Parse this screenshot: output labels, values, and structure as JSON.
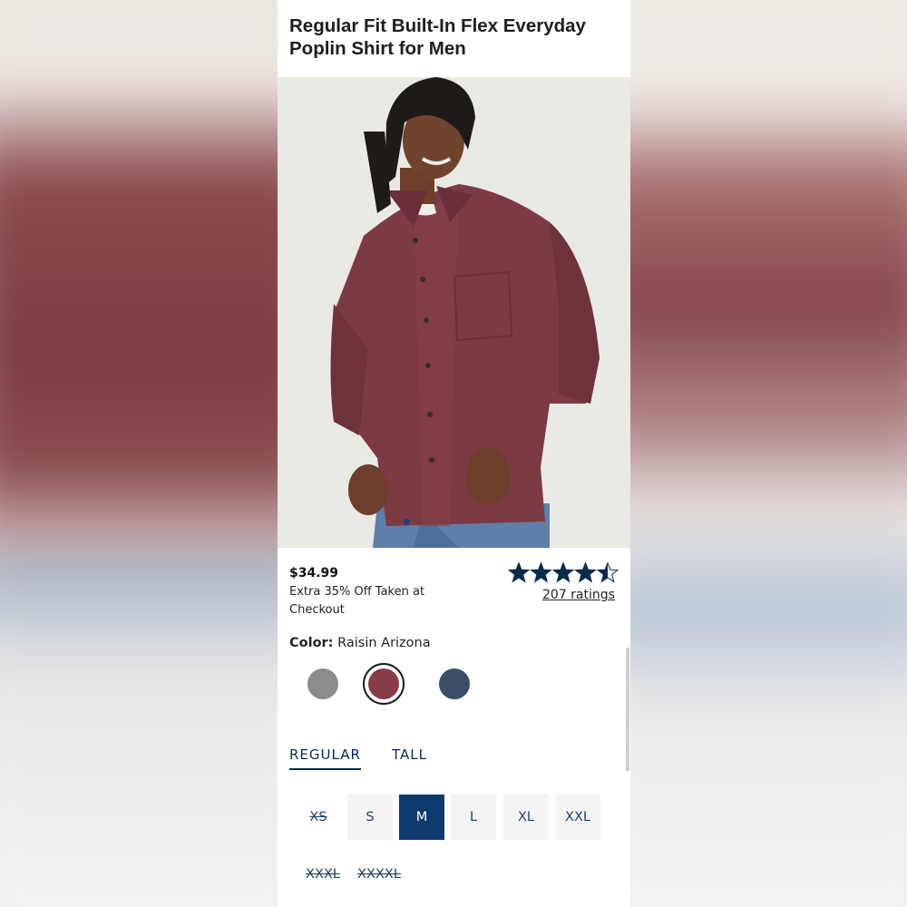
{
  "product": {
    "title": "Regular Fit Built-In Flex Everyday Poplin Shirt for Men",
    "price": "$34.99",
    "promo": "Extra 35% Off Taken at Checkout",
    "rating": {
      "value": 4.5,
      "max": 5,
      "ratings_label": "207 ratings"
    }
  },
  "color": {
    "label": "Color:",
    "selected_name": "Raisin Arizona",
    "swatches": [
      {
        "name": "grey-swatch",
        "hex": "#8c8c8c",
        "selected": false
      },
      {
        "name": "raisin-swatch",
        "hex": "#8a3b48",
        "selected": true
      },
      {
        "name": "navy-swatch",
        "hex": "#3a4e68",
        "selected": false
      }
    ]
  },
  "fit_tabs": [
    {
      "label": "REGULAR",
      "active": true
    },
    {
      "label": "TALL",
      "active": false
    }
  ],
  "sizes": [
    {
      "label": "XS",
      "state": "out-of-stock"
    },
    {
      "label": "S",
      "state": "available"
    },
    {
      "label": "M",
      "state": "selected"
    },
    {
      "label": "L",
      "state": "available"
    },
    {
      "label": "XL",
      "state": "available"
    },
    {
      "label": "XXL",
      "state": "available"
    },
    {
      "label": "XXXL",
      "state": "out-of-stock"
    },
    {
      "label": "XXXXL",
      "state": "out-of-stock"
    }
  ],
  "colors": {
    "accent": "#0e3a6e",
    "star": "#0b2a4a"
  }
}
